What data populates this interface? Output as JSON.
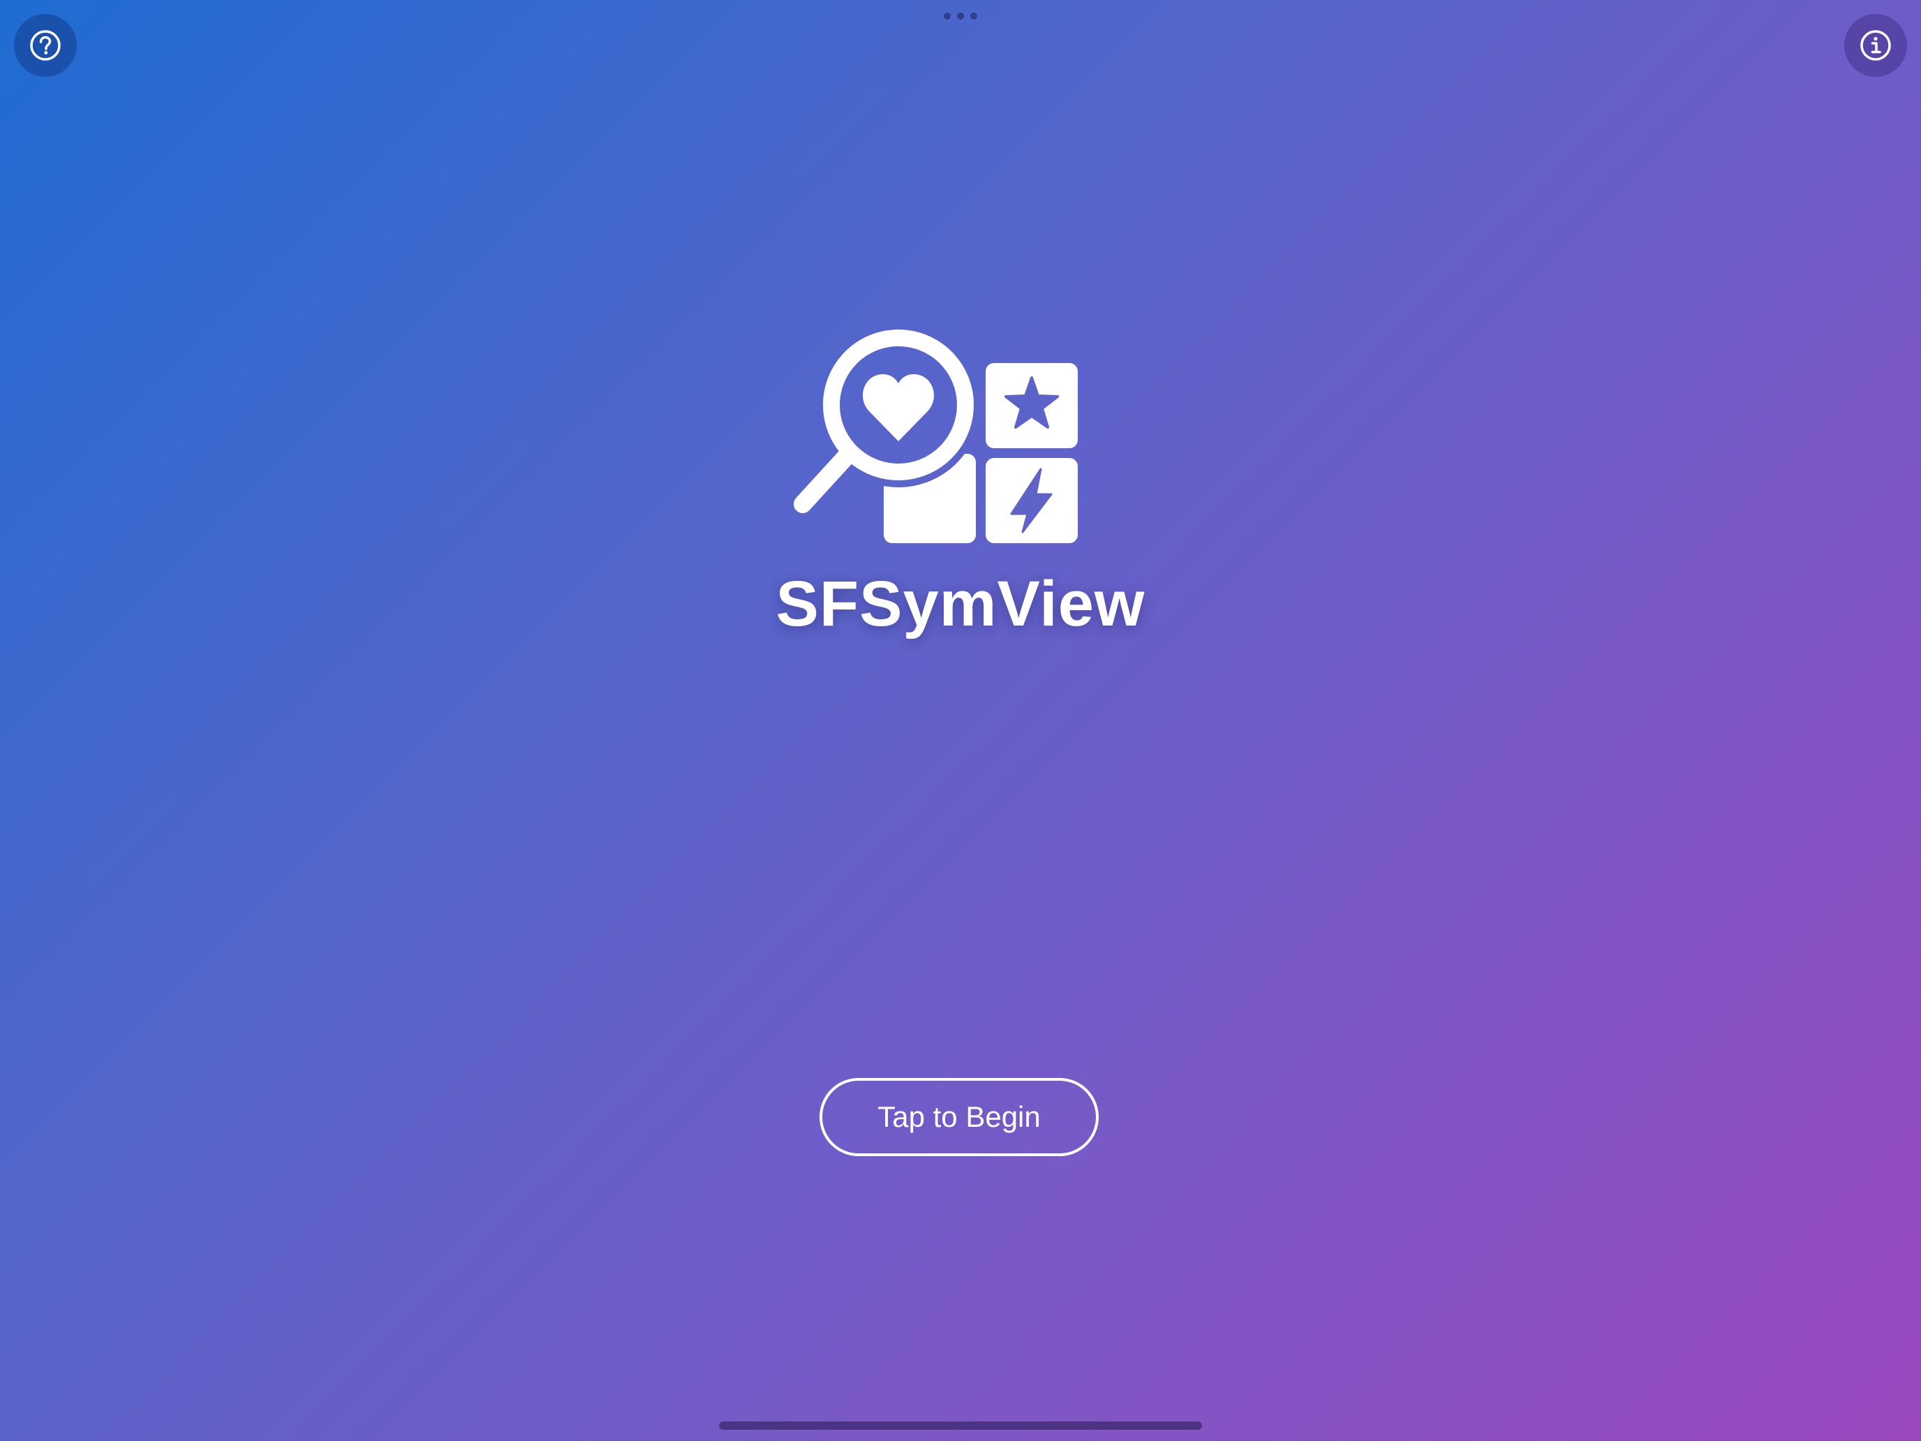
{
  "app": {
    "title": "SFSymView"
  },
  "actions": {
    "begin_label": "Tap to Begin"
  },
  "icons": {
    "help": "questionmark-circle-icon",
    "info": "info-circle-icon",
    "logo": "app-logo-magnifier-heart-star-bolt"
  },
  "colors": {
    "gradient_start": "#1f6cd2",
    "gradient_end": "#9a48be",
    "foreground": "#ffffff"
  }
}
